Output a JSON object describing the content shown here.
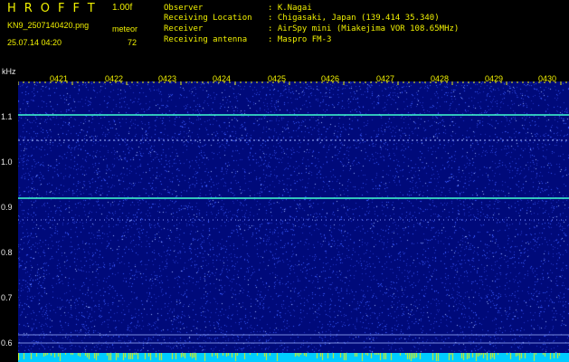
{
  "header": {
    "logo": "HROFFT",
    "version": "1.00f",
    "filename": "KN9_2507140420.png",
    "meteor_label": "meteor",
    "timestamp": "25.07.14 04:20",
    "meteor_count": "72"
  },
  "info": [
    {
      "label": "Observer",
      "value": ": K.Nagai"
    },
    {
      "label": "Receiving Location",
      "value": ": Chigasaki, Japan (139.414 35.340)"
    },
    {
      "label": "Receiver",
      "value": ": AirSpy mini (Miakejima VOR 108.65MHz)"
    },
    {
      "label": "Receiving antenna",
      "value": ": Maspro FM-3"
    }
  ],
  "axis": {
    "y_unit": "kHz",
    "y_ticks": [
      "1.1",
      "1.0",
      "0.9",
      "0.8",
      "0.7",
      "0.6"
    ],
    "x_ticks": [
      "0421",
      "0422",
      "0423",
      "0424",
      "0425",
      "0426",
      "0427",
      "0428",
      "0429",
      "0430"
    ]
  },
  "colors": {
    "background": "#000a7a",
    "noise": "#3a5bff",
    "line": "#40ffd0",
    "text_yellow": "#f0f000",
    "strip": "#00ccff"
  }
}
